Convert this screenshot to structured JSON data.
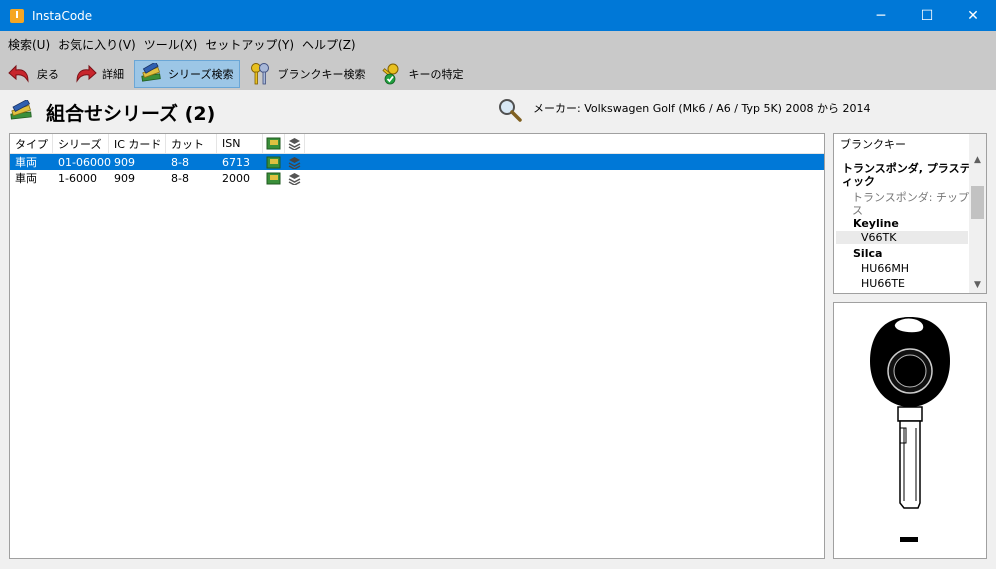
{
  "window": {
    "title": "InstaCode",
    "controls": {
      "minimize": "─",
      "maximize": "☐",
      "close": "✕"
    }
  },
  "menu": [
    {
      "label": "検索(U)"
    },
    {
      "label": "お気に入り(V)"
    },
    {
      "label": "ツール(X)"
    },
    {
      "label": "セットアップ(Y)"
    },
    {
      "label": "ヘルプ(Z)"
    }
  ],
  "toolbar": {
    "back": {
      "label": "戻る",
      "icon": "back-arrow-icon"
    },
    "details": {
      "label": "詳細",
      "icon": "forward-arrow-icon"
    },
    "series_search": {
      "label": "シリーズ検索",
      "icon": "books-icon",
      "active": true
    },
    "blank_key_search": {
      "label": "ブランクキー検索",
      "icon": "keys-icon"
    },
    "key_identify": {
      "label": "キーの特定",
      "icon": "key-check-icon"
    }
  },
  "header": {
    "title": "組合せシリーズ (2)",
    "vehicle": "メーカー: Volkswagen Golf (Mk6 / A6 / Typ 5K) 2008 から 2014"
  },
  "table": {
    "columns": [
      "タイプ",
      "シリーズ",
      "IC カード",
      "カット",
      "ISN"
    ],
    "rows": [
      {
        "type": "車両",
        "series": "01-06000",
        "ic_card": "909",
        "cut": "8-8",
        "isn": "6713",
        "selected": true
      },
      {
        "type": "車両",
        "series": "1-6000",
        "ic_card": "909",
        "cut": "8-8",
        "isn": "2000",
        "selected": false
      }
    ]
  },
  "blank_keys": {
    "title": "ブランクキー",
    "items": [
      {
        "label": "トランスポンダ, プラスティ",
        "style": "bold"
      },
      {
        "label": "ィック",
        "style": "bold"
      },
      {
        "label": "トランスポンダ: チップレ",
        "style": "gray"
      },
      {
        "label": "ス",
        "style": "gray"
      },
      {
        "label": "Keyline",
        "style": "bold"
      },
      {
        "label": "V66TK",
        "style": "highlight"
      },
      {
        "label": "Silca",
        "style": "bold"
      },
      {
        "label": "HU66MH",
        "style": "normal"
      },
      {
        "label": "HU66TE",
        "style": "normal"
      }
    ]
  },
  "colors": {
    "titlebar": "#0078d7",
    "selection": "#0078d7",
    "toolbar_bg": "#c9c9c9",
    "active_tool": "#9cc6e6"
  }
}
